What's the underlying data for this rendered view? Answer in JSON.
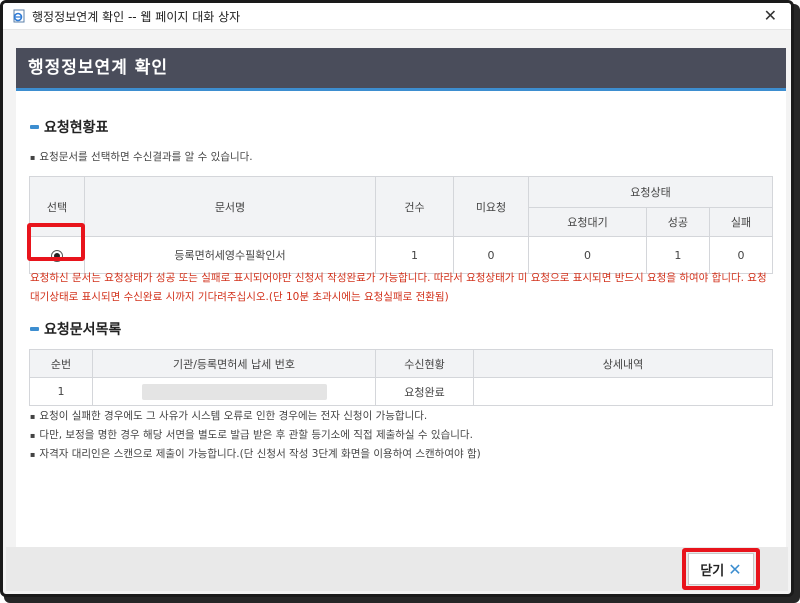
{
  "window": {
    "title": "행정정보연계 확인 -- 웹 페이지 대화 상자",
    "close_glyph": "✕"
  },
  "header": {
    "title": "행정정보연계 확인"
  },
  "request_status": {
    "section_title": "요청현황표",
    "note": "요청문서를 선택하면 수신결과를 알 수 있습니다.",
    "columns": {
      "select": "선택",
      "doc_name": "문서명",
      "count": "건수",
      "not_requested": "미요청",
      "status_group": "요청상태",
      "waiting": "요청대기",
      "success": "성공",
      "failure": "실패"
    },
    "rows": [
      {
        "selected": true,
        "doc_name": "등록면허세영수필확인서",
        "count": "1",
        "not_requested": "0",
        "waiting": "0",
        "success": "1",
        "failure": "0"
      }
    ],
    "warning": "요청하신 문서는 요청상태가 성공 또는 실패로 표시되어야만 신청서 작성완료가 가능합니다. 따라서 요청상태가 미 요청으로 표시되면 반드시 요청을 하여야 합니다. 요청 대기상태로 표시되면 수신완료 시까지 기다려주십시오.(단 10분 초과시에는 요청실패로 전환됨)"
  },
  "request_docs": {
    "section_title": "요청문서목록",
    "columns": {
      "no": "순번",
      "org_tax_no": "기관/등록면허세 납세 번호",
      "receive_status": "수신현황",
      "details": "상세내역"
    },
    "rows": [
      {
        "no": "1",
        "org_tax_no": "",
        "receive_status": "요청완료",
        "details": ""
      }
    ],
    "notes": [
      "요청이 실패한 경우에도 그 사유가 시스템 오류로 인한 경우에는 전자 신청이 가능합니다.",
      "다만, 보정을 명한 경우 해당 서면을 별도로 발급 받은 후 관할 등기소에 직접 제출하실 수 있습니다.",
      "자격자 대리인은 스캔으로 제출이 가능합니다.(단 신청서 작성 3단계 화면을 이용하여 스캔하여야 함)"
    ]
  },
  "footer": {
    "close_label": "닫기",
    "close_glyph": "✕"
  },
  "colors": {
    "accent": "#3d8ed0",
    "header_bg": "#4a4d5b",
    "warning": "#d2321c",
    "highlight": "#e8141c"
  }
}
